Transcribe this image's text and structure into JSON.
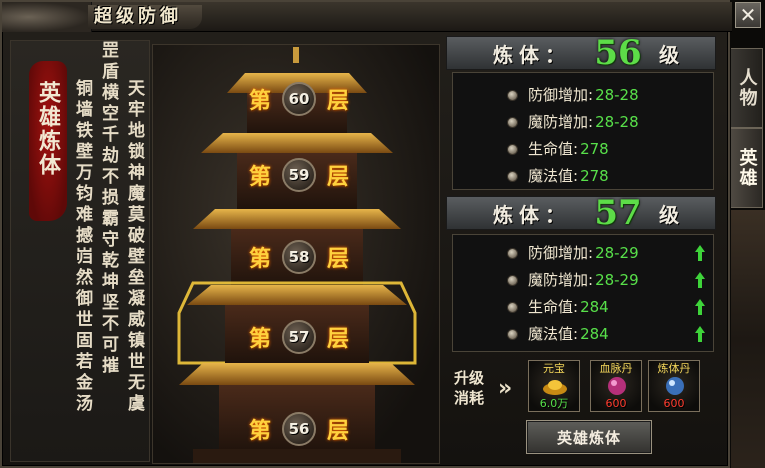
{
  "window": {
    "title": "超级防御"
  },
  "poem": {
    "seal": "英雄炼体",
    "columns": [
      "天牢地锁神魔莫破壁垒凝威镇世无虞",
      "罡盾横空千劫不损霸守乾坤坚不可摧",
      "铜墙铁壁万钧难撼岿然御世固若金汤"
    ]
  },
  "pagoda": {
    "floors": [
      {
        "prefix": "第",
        "number": "60",
        "suffix": "层"
      },
      {
        "prefix": "第",
        "number": "59",
        "suffix": "层"
      },
      {
        "prefix": "第",
        "number": "58",
        "suffix": "层"
      },
      {
        "prefix": "第",
        "number": "57",
        "suffix": "层"
      },
      {
        "prefix": "第",
        "number": "56",
        "suffix": "层"
      }
    ],
    "highlighted_floor": "57"
  },
  "current": {
    "label": "炼体：",
    "level": "56",
    "unit": "级",
    "stats": [
      {
        "name": "防御增加:",
        "value": "28-28"
      },
      {
        "name": "魔防增加:",
        "value": "28-28"
      },
      {
        "name": "生命值:",
        "value": "278"
      },
      {
        "name": "魔法值:",
        "value": "278"
      }
    ]
  },
  "next": {
    "label": "炼体：",
    "level": "57",
    "unit": "级",
    "stats": [
      {
        "name": "防御增加:",
        "value": "28-29",
        "icon": "up-arrow-icon"
      },
      {
        "name": "魔防增加:",
        "value": "28-29",
        "icon": "up-arrow-icon"
      },
      {
        "name": "生命值:",
        "value": "284",
        "icon": "up-arrow-icon"
      },
      {
        "name": "魔法值:",
        "value": "284",
        "icon": "up-arrow-icon"
      }
    ]
  },
  "cost": {
    "label": "升级消耗",
    "arrow": "»",
    "items": [
      {
        "name": "元宝",
        "amount": "6.0万",
        "icon": "gold-ingot-icon",
        "amount_color": "#56e04a"
      },
      {
        "name": "血脉丹",
        "amount": "600",
        "icon": "blood-pill-icon",
        "amount_color": "#ff3b2e"
      },
      {
        "name": "炼体丹",
        "amount": "600",
        "icon": "body-pill-icon",
        "amount_color": "#ff3b2e"
      }
    ]
  },
  "actions": {
    "upgrade_label": "英雄炼体",
    "close_label": "✕"
  },
  "tabs": [
    {
      "label": "人物",
      "active": false
    },
    {
      "label": "英雄",
      "active": true
    }
  ],
  "colors": {
    "stat_value": "#58e04a",
    "level_value": "#5ddc48",
    "floor_text": "#ffd23e"
  }
}
